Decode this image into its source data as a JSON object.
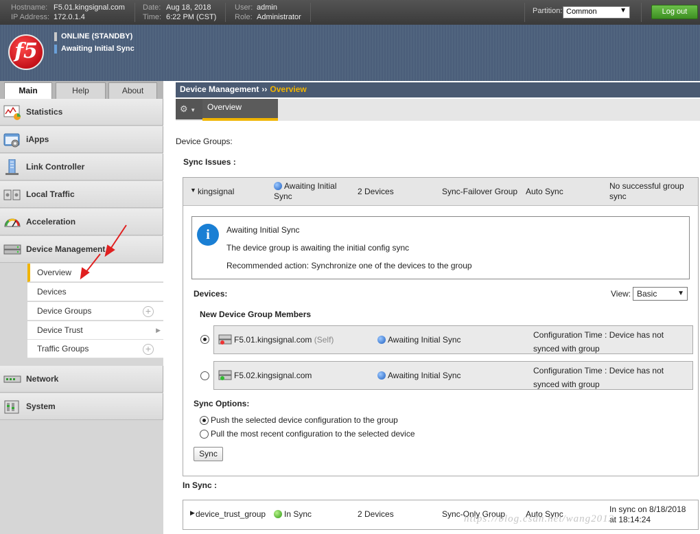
{
  "topbar": {
    "hostname_label": "Hostname:",
    "hostname": "F5.01.kingsignal.com",
    "ip_label": "IP Address:",
    "ip": "172.0.1.4",
    "date_label": "Date:",
    "date": "Aug 18, 2018",
    "time_label": "Time:",
    "time": "6:22 PM (CST)",
    "user_label": "User:",
    "user": "admin",
    "role_label": "Role:",
    "role": "Administrator",
    "partition_label": "Partition:",
    "partition": "Common",
    "logout": "Log out"
  },
  "header": {
    "status": "ONLINE (STANDBY)",
    "sync_status": "Awaiting Initial Sync",
    "logo": "f5"
  },
  "tabs": [
    "Main",
    "Help",
    "About"
  ],
  "sidebar": {
    "items": [
      {
        "label": "Statistics",
        "icon": "statistics-icon"
      },
      {
        "label": "iApps",
        "icon": "iapps-icon"
      },
      {
        "label": "Link Controller",
        "icon": "link-controller-icon"
      },
      {
        "label": "Local Traffic",
        "icon": "local-traffic-icon"
      },
      {
        "label": "Acceleration",
        "icon": "acceleration-icon"
      },
      {
        "label": "Device Management",
        "icon": "device-management-icon"
      }
    ],
    "sub": [
      "Overview",
      "Devices",
      "Device Groups",
      "Device Trust",
      "Traffic Groups"
    ],
    "items2": [
      {
        "label": "Network",
        "icon": "network-icon"
      },
      {
        "label": "System",
        "icon": "system-icon"
      }
    ]
  },
  "breadcrumb": {
    "section": "Device Management",
    "sep": "››",
    "current": "Overview"
  },
  "subtab": "Overview",
  "content": {
    "device_groups_label": "Device Groups:",
    "sync_issues_label": "Sync Issues :",
    "group": {
      "name": "kingsignal",
      "status_l1": "Awaiting Initial",
      "status_l2": "Sync",
      "devices": "2 Devices",
      "type": "Sync-Failover Group",
      "mode": "Auto Sync",
      "note_l1": "No successful group",
      "note_l2": "sync"
    },
    "info": {
      "title": "Awaiting Initial Sync",
      "desc": "The device group is awaiting the initial config sync",
      "action": "Recommended action: Synchronize one of the devices to the group"
    },
    "devices_label": "Devices:",
    "view_label": "View:",
    "view_value": "Basic",
    "members_label": "New Device Group Members",
    "members": [
      {
        "name": "F5.01.kingsignal.com",
        "self": "(Self)",
        "status": "Awaiting Initial Sync",
        "cfg_l1": "Configuration Time : Device has not",
        "cfg_l2": "synced with group"
      },
      {
        "name": "F5.02.kingsignal.com",
        "self": "",
        "status": "Awaiting Initial Sync",
        "cfg_l1": "Configuration Time : Device has not",
        "cfg_l2": "synced with group"
      }
    ],
    "sync_options_label": "Sync Options:",
    "opt_push": "Push the selected device configuration to the group",
    "opt_pull": "Pull the most recent configuration to the selected device",
    "sync_button": "Sync",
    "in_sync_label": "In Sync :",
    "in_sync_group": {
      "name": "device_trust_group",
      "status": "In Sync",
      "devices": "2 Devices",
      "type": "Sync-Only Group",
      "mode": "Auto Sync",
      "note_l1": "In sync on 8/18/2018",
      "note_l2": "at 18:14:24"
    }
  },
  "watermark": "https://blog.csdn.net/wang2012"
}
